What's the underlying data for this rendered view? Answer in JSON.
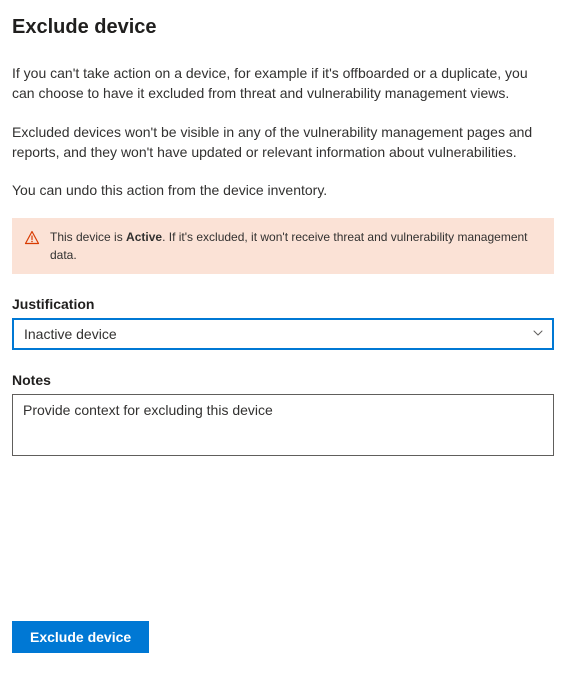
{
  "header": {
    "title": "Exclude device"
  },
  "description": {
    "para1": "If you can't take action on a device, for example if it's offboarded or a duplicate, you can choose to have it excluded from threat and vulnerability management views.",
    "para2": "Excluded devices won't be visible in any of the vulnerability management pages and reports, and they won't have updated or relevant information about vulnerabilities.",
    "para3": "You can undo this action from the device inventory."
  },
  "alert": {
    "prefix": "This device is ",
    "status": "Active",
    "suffix": ". If it's excluded, it won't receive threat and vulnerability management data."
  },
  "justification": {
    "label": "Justification",
    "selected": "Inactive device"
  },
  "notes": {
    "label": "Notes",
    "placeholder": "Provide context for excluding this device",
    "value": ""
  },
  "actions": {
    "submit_label": "Exclude device"
  }
}
